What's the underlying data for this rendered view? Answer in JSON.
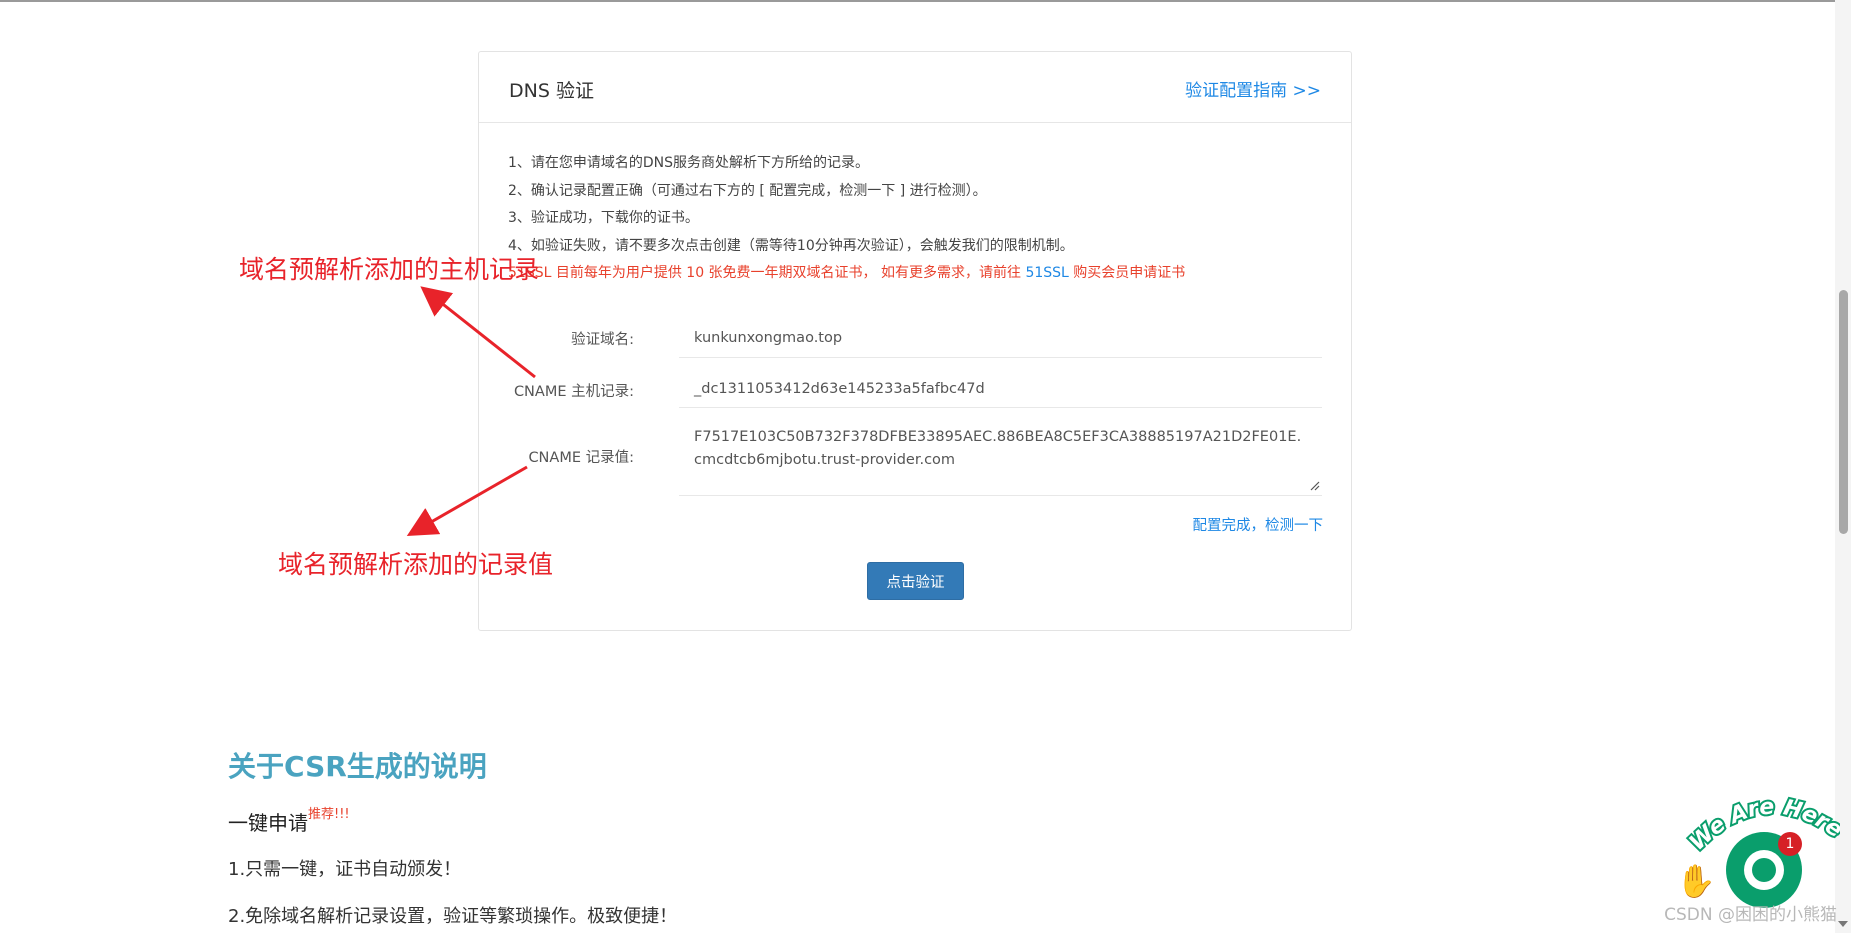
{
  "card": {
    "title": "DNS 验证",
    "guide_link": "验证配置指南 >>",
    "instructions": [
      "1、请在您申请域名的DNS服务商处解析下方所给的记录。",
      "2、确认记录配置正确（可通过右下方的 [ 配置完成，检测一下 ] 进行检测）。",
      "3、验证成功，下载你的证书。",
      "4、如验证失败，请不要多次点击创建（需等待10分钟再次验证），会触发我们的限制机制。"
    ],
    "promo_prefix": "51SSL 目前每年为用户提供 10 张免费一年期双域名证书， 如有更多需求，请前往 ",
    "promo_link": "51SSL",
    "promo_suffix": " 购买会员申请证书",
    "fields": {
      "domain_label": "验证域名:",
      "domain_value": "kunkunxongmao.top",
      "cname_host_label": "CNAME 主机记录:",
      "cname_host_value": "_dc1311053412d63e145233a5fafbc47d",
      "cname_value_label": "CNAME 记录值:",
      "cname_value": "F7517E103C50B732F378DFBE33895AEC.886BEA8C5EF3CA38885197A21D2FE01E.cmcdtcb6mjbotu.trust-provider.com"
    },
    "check_link": "配置完成，检测一下",
    "verify_button": "点击验证"
  },
  "annotations": {
    "host_record": "域名预解析添加的主机记录",
    "record_value": "域名预解析添加的记录值"
  },
  "csr_section": {
    "title": "关于CSR生成的说明",
    "one_click": "一键申请",
    "recommend": "推荐!!!",
    "line1": "1.只需一键，证书自动颁发！",
    "line2": "2.免除域名解析记录设置，验证等繁琐操作。极致便捷！"
  },
  "chat_widget": {
    "tagline": "We Are Here!",
    "badge_count": "1"
  },
  "watermark": "CSDN @困困的小熊猫",
  "colors": {
    "accent_blue": "#1e88e5",
    "button_blue": "#337ab7",
    "annotation_red": "#e8232a",
    "section_title": "#4aa3c0",
    "chat_green": "#0a9e6c"
  }
}
